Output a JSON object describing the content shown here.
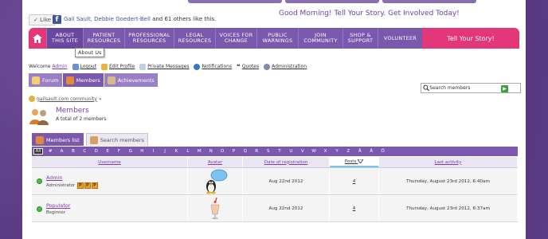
{
  "facebook": {
    "like_label": "Like",
    "like_names": "Gail Sault, Debbie Goedert-Bell",
    "like_rest": " and 61 others like this."
  },
  "greeting": "Good Morning! Tell Your Story. Get Involved Today!",
  "nav": {
    "items": [
      {
        "label": "ABOUT THIS SITE"
      },
      {
        "label": "PATIENT RESOURCES"
      },
      {
        "label": "PROFESSIONAL RESOURCES"
      },
      {
        "label": "LEGAL RESOURCES"
      },
      {
        "label": "VOICES FOR CHANGE"
      },
      {
        "label": "PUBLIC WARNINGS"
      },
      {
        "label": "JOIN COMMUNITY"
      },
      {
        "label": "SHOP & SUPPORT"
      },
      {
        "label": "VOLUNTEER"
      }
    ],
    "cta": "Tell Your Story!",
    "tooltip": "About Us",
    "colors": {
      "purple": "#7a58ae",
      "pink": "#e4377a"
    }
  },
  "userbar": {
    "welcome": "Welcome",
    "username": "Admin",
    "links": [
      "Logout",
      "Edit Profile",
      "Private Messages",
      "Notifications",
      "Quotes",
      "Administration"
    ]
  },
  "section_tabs": [
    "Forum",
    "Members",
    "Achievements"
  ],
  "search": {
    "placeholder": "Search members",
    "value": "Search members"
  },
  "breadcrumb": {
    "site": "gailsault.com community",
    "sep": "»"
  },
  "members": {
    "title": "Members",
    "count_text": "A total of 2 members"
  },
  "member_tabs": [
    "Members list",
    "Search members"
  ],
  "letters": [
    "All",
    "#",
    "A",
    "B",
    "C",
    "D",
    "E",
    "F",
    "G",
    "H",
    "I",
    "J",
    "K",
    "L",
    "M",
    "N",
    "O",
    "P",
    "Q",
    "R",
    "S",
    "T",
    "U",
    "V",
    "W",
    "X",
    "Y",
    "Z",
    "Å",
    "Ä",
    "Ö"
  ],
  "table": {
    "headers": {
      "username": "Username",
      "avatar": "Avatar",
      "date": "Date of registration",
      "posts": "Posts",
      "last": "Last activity"
    },
    "rows": [
      {
        "name": "Admin",
        "role": "Administrator",
        "badges": [
          "P",
          "P",
          "P"
        ],
        "avatar": "tux-with-speech-bubble",
        "date": "Aug 22nd 2012",
        "posts": "4",
        "last": "Thursday, August 23rd 2012, 6:40am"
      },
      {
        "name": "Populator",
        "role": "Beginner",
        "badges": [],
        "avatar": "milkshake",
        "date": "Aug 22nd 2012",
        "posts": "4",
        "last": "Thursday, August 23rd 2012, 6:37am"
      }
    ]
  }
}
